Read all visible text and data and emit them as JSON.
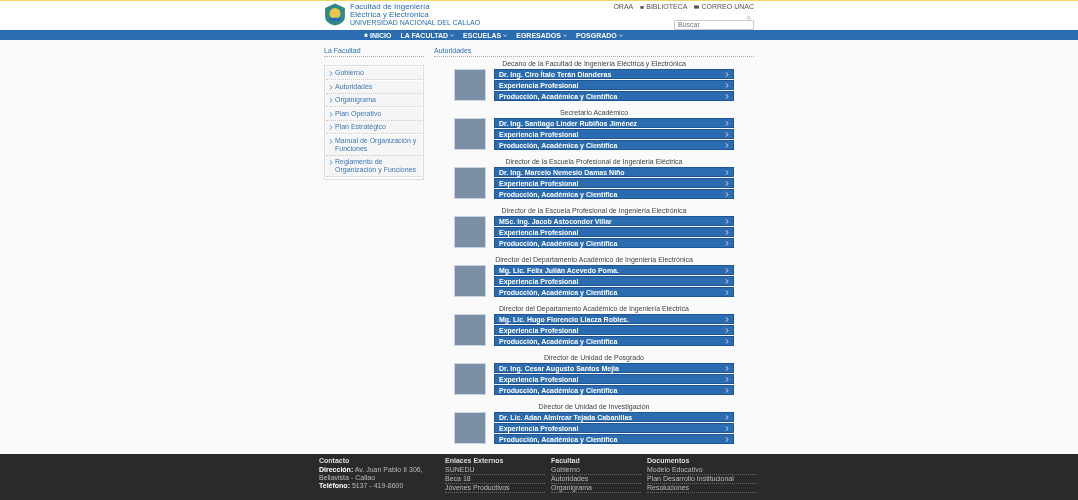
{
  "header": {
    "title_line_1": "Facultad de Ingeniería",
    "title_line_2": "Eléctrica y Electrónica",
    "subtitle": "UNIVERSIDAD NACIONAL DEL CALLAO",
    "links": [
      "ORAA",
      "BIBLIOTECA",
      "CORREO UNAC"
    ],
    "search": {
      "placeholder": "Buscar"
    }
  },
  "nav": [
    {
      "label": "INICIO",
      "kind": "home"
    },
    {
      "label": "LA FACULTAD",
      "kind": "dropdown"
    },
    {
      "label": "ESCUELAS",
      "kind": "dropdown"
    },
    {
      "label": "EGRESADOS",
      "kind": "dropdown"
    },
    {
      "label": "POSGRADO",
      "kind": "dropdown"
    }
  ],
  "sidebar": {
    "title": "La Facultad",
    "items": [
      "Gobierno",
      "Autoridades",
      "Organigrama",
      "Plan Operativo",
      "Plan Estratégico",
      "Manual de Organización y Funciones",
      "Reglamento de Organización y Funciones"
    ]
  },
  "content": {
    "title": "Autoridades",
    "sections": [
      {
        "role": "Decano de la Facultad de Ingeniería Eléctrica y Electrónica",
        "buttons": [
          "Dr. Ing. Ciro Ítalo Terán Dianderas",
          "Experiencia Profesional",
          "Producción, Académica y Científica"
        ]
      },
      {
        "role": "Secretario Académico",
        "buttons": [
          "Dr. Ing. Santiago Linder Rubiños Jiménez",
          "Experiencia Profesional",
          "Producción, Académica y Científica"
        ]
      },
      {
        "role": "Director de la Escuela Profesional de Ingeniería Eléctrica",
        "buttons": [
          "Dr. Ing. Marcelo Nemesio Damas Niño",
          "Experiencia Profesional",
          "Producción, Académica y Científica"
        ]
      },
      {
        "role": "Director de la Escuela Profesional de Ingeniería Electrónica",
        "buttons": [
          "MSc. Ing. Jacob Astocondor Villar",
          "Experiencia Profesional",
          "Producción, Académica y Científica"
        ]
      },
      {
        "role": "Director del Departamento Académico de Ingeniería Electrónica",
        "buttons": [
          "Mg. Lic. Félix Julián Acevedo Poma.",
          "Experiencia Profesional",
          "Producción, Académica y Científica"
        ]
      },
      {
        "role": "Director del Departamento Académico de Ingeniería Eléctrica",
        "buttons": [
          "Mg. Lic. Hugo Florencio Llacza Robles.",
          "Experiencia Profesional",
          "Producción, Académica y Científica"
        ]
      },
      {
        "role": "Director de Unidad de Posgrado",
        "buttons": [
          "Dr. Ing. Cesar Augusto Santos Mejía",
          "Experiencia Profesional",
          "Producción, Académica y Científica"
        ]
      },
      {
        "role": "Director de Unidad de Investigación",
        "buttons": [
          "Dr. Lic. Adan Almircar Tejada Cabanillas",
          "Experiencia Profesional",
          "Producción, Académica y Científica"
        ]
      }
    ]
  },
  "footer": [
    {
      "title": "Contacto",
      "kind": "text",
      "lines": [
        "**Dirección:** Av. Juan Pablo II 306, Bellavista - Callao",
        "**Teléfono:** 5137 - 419-8600"
      ]
    },
    {
      "title": "Enlaces Externos",
      "kind": "links",
      "lines": [
        "SUNEDU",
        "Beca 18",
        "Jóvenes Productivos"
      ]
    },
    {
      "title": "Facultad",
      "kind": "links",
      "lines": [
        "Gobierno",
        "Autoridades",
        "Organigrama"
      ]
    },
    {
      "title": "Documentos",
      "kind": "links",
      "lines": [
        "Modelo Educativo",
        "Plan Desarrollo Institucional",
        "Resoluciones"
      ]
    }
  ]
}
